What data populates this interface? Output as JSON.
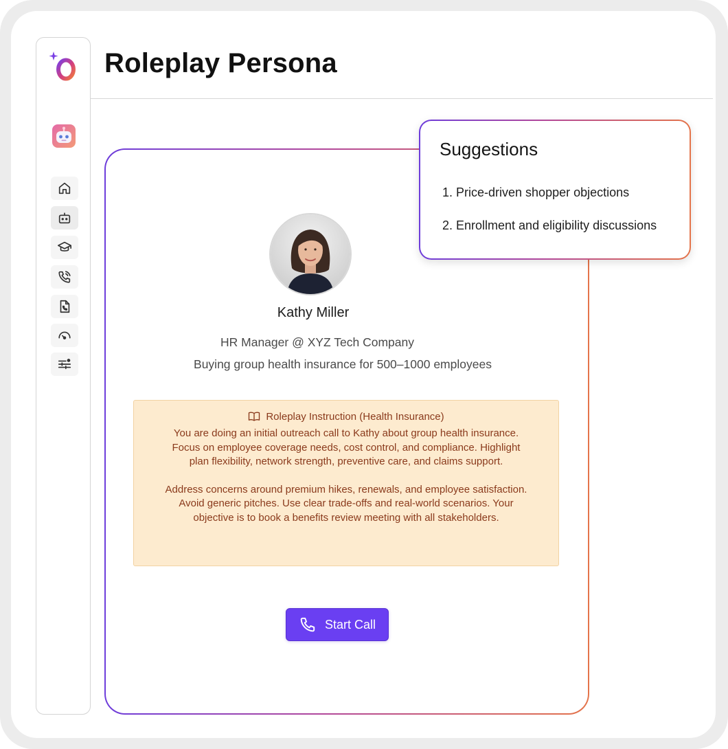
{
  "page": {
    "title": "Roleplay Persona"
  },
  "sidebar": {
    "items": [
      {
        "icon": "home-icon"
      },
      {
        "icon": "bot-icon"
      },
      {
        "icon": "graduation-cap-icon"
      },
      {
        "icon": "phone-call-icon"
      },
      {
        "icon": "document-phone-icon"
      },
      {
        "icon": "gauge-icon"
      },
      {
        "icon": "sliders-icon"
      }
    ]
  },
  "persona": {
    "name": "Kathy Miller",
    "role": "HR Manager @ XYZ Tech Company",
    "goal": "Buying group health insurance for 500–1000 employees"
  },
  "instruction": {
    "heading": "Roleplay Instruction (Health Insurance)",
    "paragraph1": "You are doing an initial outreach call to Kathy about group health insurance. Focus on employee coverage needs, cost control, and compliance. Highlight plan flexibility, network strength, preventive care, and claims support.",
    "paragraph2": "Address concerns around premium hikes, renewals, and employee satisfaction. Avoid generic pitches. Use clear trade-offs and real-world scenarios. Your objective is to book a benefits review meeting with all stakeholders."
  },
  "actions": {
    "start_call_label": "Start Call"
  },
  "suggestions": {
    "title": "Suggestions",
    "items": [
      "1. Price-driven shopper objections",
      "2. Enrollment and eligibility discussions"
    ]
  },
  "colors": {
    "accent": "#6a3ff2",
    "gradient_start": "#6d3ddb",
    "gradient_end": "#e4744a",
    "instruction_bg": "#fdebcf",
    "instruction_text": "#8a3a1c"
  }
}
